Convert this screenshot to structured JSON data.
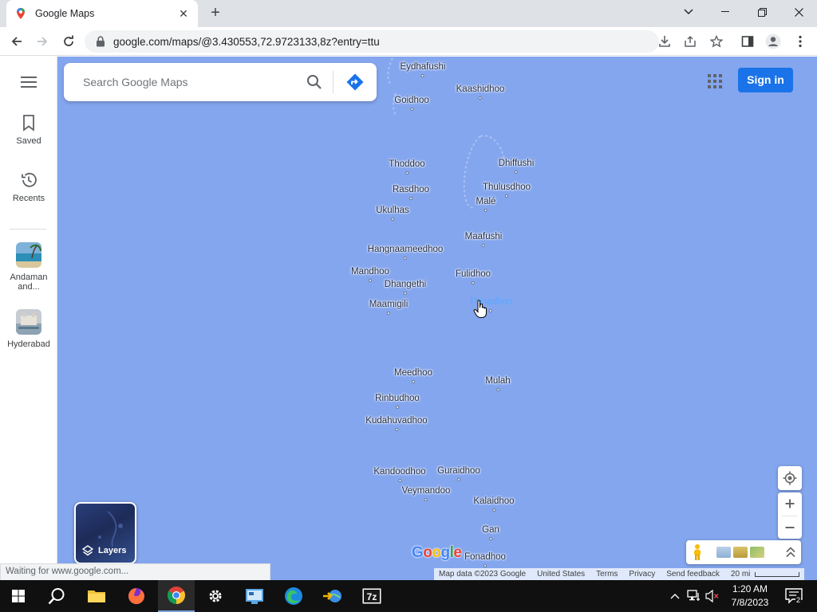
{
  "browser": {
    "tab_title": "Google Maps",
    "url": "google.com/maps/@3.430553,72.9723133,8z?entry=ttu",
    "status_text": "Waiting for www.google.com..."
  },
  "rail": {
    "saved_label": "Saved",
    "recents_label": "Recents",
    "recent_places": [
      {
        "label": "Andaman and..."
      },
      {
        "label": "Hyderabad"
      }
    ]
  },
  "search": {
    "placeholder": "Search Google Maps"
  },
  "header": {
    "signin_label": "Sign in"
  },
  "map": {
    "places": [
      "Eydhafushi",
      "Kaashidhoo",
      "Goidhoo",
      "Thoddoo",
      "Dhiffushi",
      "Rasdhoo",
      "Thulusdhoo",
      "Ukulhas",
      "Malé",
      "Maafushi",
      "Hangnaameedhoo",
      "Mandhoo",
      "Fulidhoo",
      "Dhangethi",
      "Thinadhoo",
      "Maamigili",
      "Meedhoo",
      "Mulah",
      "Rinbudhoo",
      "Kudahuvadhoo",
      "Kandoodhoo",
      "Guraidhoo",
      "Veymandoo",
      "Kalaidhoo",
      "Gan",
      "Fonadhoo"
    ],
    "hovered_place": "Thinadhoo",
    "layers_label": "Layers",
    "logo": [
      "G",
      "o",
      "o",
      "g",
      "l",
      "e"
    ],
    "logo_colors": [
      "#4285f4",
      "#ea4335",
      "#fbbc05",
      "#4285f4",
      "#34a853",
      "#ea4335"
    ],
    "water_color": "#84a6ee"
  },
  "attribution": {
    "map_data": "Map data ©2023 Google",
    "country": "United States",
    "terms": "Terms",
    "privacy": "Privacy",
    "feedback": "Send feedback",
    "scale": "20 mi"
  },
  "taskbar": {
    "time": "1:20 AM",
    "date": "7/8/2023",
    "notification_count": "2"
  }
}
